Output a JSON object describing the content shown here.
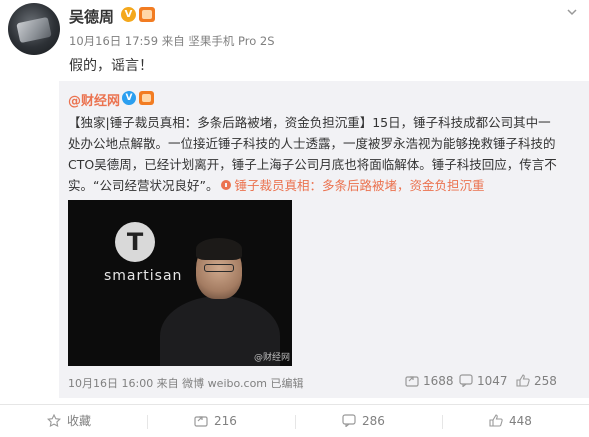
{
  "post": {
    "author": "吴德周",
    "meta": "10月16日 17:59 来自 坚果手机 Pro 2S",
    "text": "假的，谣言！",
    "badges": {
      "verified": "V"
    }
  },
  "repost": {
    "author": "@财经网",
    "badge": "V",
    "text_prefix": "【独家|锤子裁员真相：多条后路被堵，资金负担沉重】15日，锤子科技成都公司其中一处办公地点解散。一位接近锤子科技的人士透露，一度被罗永浩视为能够挽救锤子科技的CTO吴德周，已经计划离开，锤子上海子公司月底也将面临解体。锤子科技回应，传言不实。“公司经营状况良好”。",
    "link_text": "锤子裁员真相：多条后路被堵，资金负担沉重",
    "image": {
      "logo_letter": "T",
      "brand": "smartisan",
      "watermark": "@财经网"
    },
    "meta": "10月16日 16:00 来自 微博 weibo.com  已编辑",
    "share_count": "1688",
    "comment_count": "1047",
    "like_count": "258"
  },
  "bottom": {
    "favorite_label": "收藏",
    "share_count": "216",
    "comment_count": "286",
    "like_count": "448"
  },
  "colors": {
    "link": "#eb7350",
    "meta": "#808080",
    "repost_bg": "#f2f2f5",
    "verified_orange": "#f4a81d",
    "verified_blue": "#2b9ff0"
  }
}
